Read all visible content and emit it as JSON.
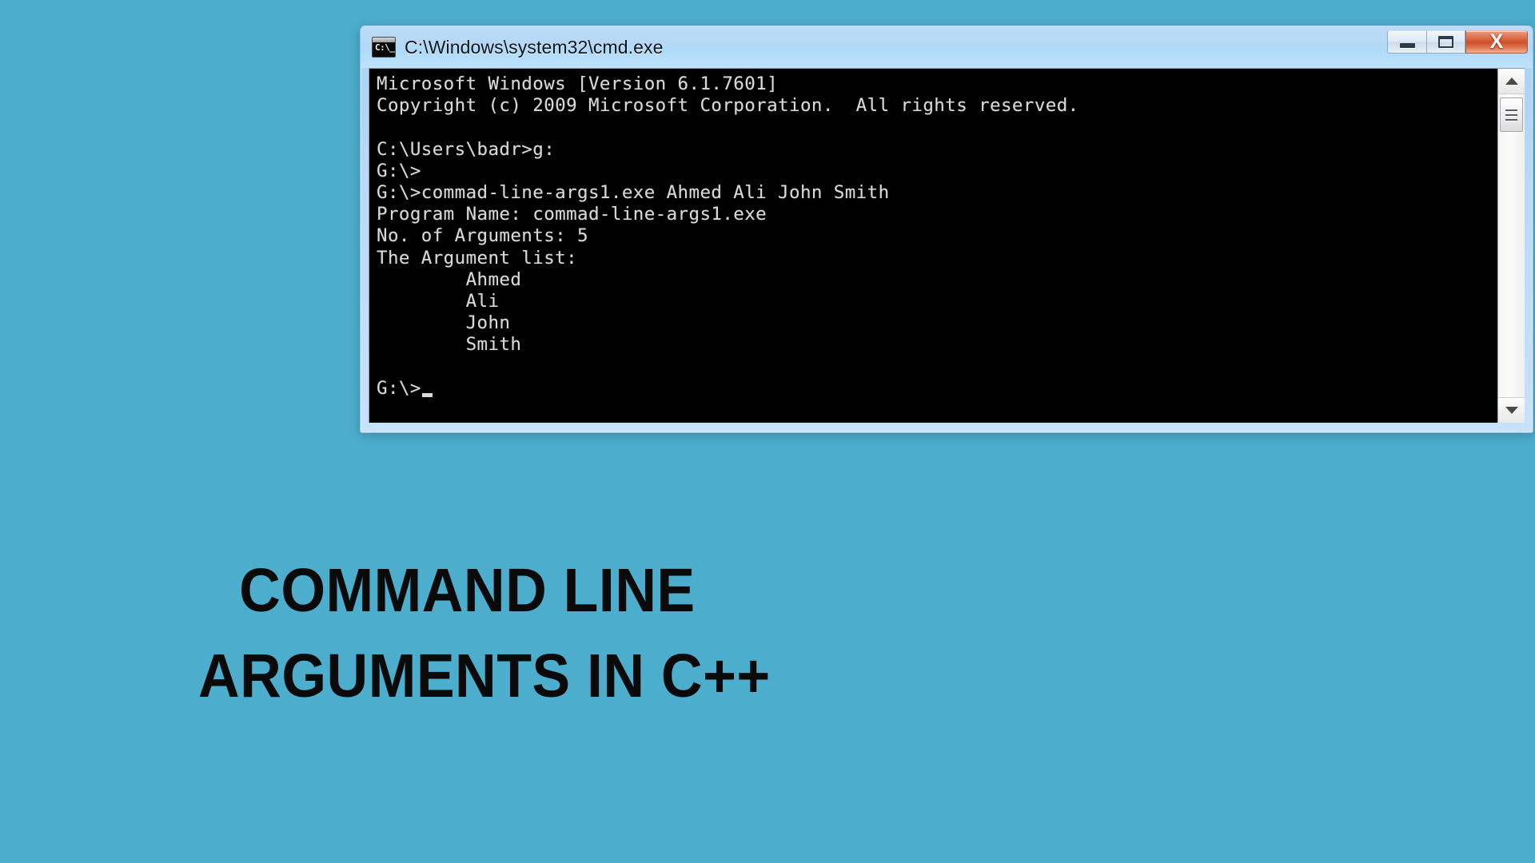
{
  "slide": {
    "background_color": "#4cadcd",
    "title_line1": "COMMAND LINE",
    "title_line2": "ARGUMENTS IN C++",
    "title_color": "#0a0a0a"
  },
  "cmd_window": {
    "title": "C:\\Windows\\system32\\cmd.exe",
    "icon": "cmd-console-icon",
    "icon_glyph": "C:\\_",
    "titlebar_color": "#b5d8f6",
    "console_background": "#000000",
    "console_foreground": "#d8d8d8",
    "controls": {
      "minimize_label": "Minimize",
      "maximize_label": "Maximize",
      "close_label": "X",
      "close_color": "#cf4e28"
    },
    "scrollbar": {
      "up_arrow_label": "Scroll up",
      "down_arrow_label": "Scroll down",
      "thumb_label": "Scroll thumb"
    },
    "console_output": "Microsoft Windows [Version 6.1.7601]\nCopyright (c) 2009 Microsoft Corporation.  All rights reserved.\n\nC:\\Users\\badr>g:\nG:\\>\nG:\\>commad-line-args1.exe Ahmed Ali John Smith\nProgram Name: commad-line-args1.exe\nNo. of Arguments: 5\nThe Argument list:\n        Ahmed\n        Ali\n        John\n        Smith\n\nG:\\>",
    "console_lines": [
      "Microsoft Windows [Version 6.1.7601]",
      "Copyright (c) 2009 Microsoft Corporation.  All rights reserved.",
      "",
      "C:\\Users\\badr>g:",
      "G:\\>",
      "G:\\>commad-line-args1.exe Ahmed Ali John Smith",
      "Program Name: commad-line-args1.exe",
      "No. of Arguments: 5",
      "The Argument list:",
      "        Ahmed",
      "        Ali",
      "        John",
      "        Smith",
      "",
      "G:\\>"
    ],
    "program_name": "commad-line-args1.exe",
    "argument_count": "5",
    "arguments": [
      "Ahmed",
      "Ali",
      "John",
      "Smith"
    ],
    "prompt": "G:\\>",
    "windows_version": "6.1.7601",
    "copyright_year": "2009"
  }
}
